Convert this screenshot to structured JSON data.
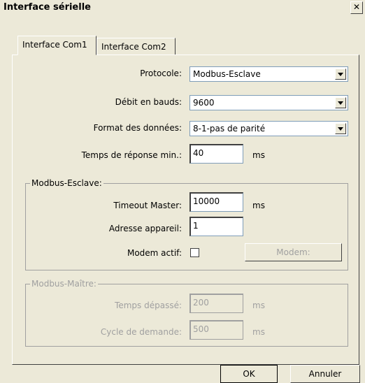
{
  "window": {
    "title": "Interface sérielle",
    "close_glyph": "✕"
  },
  "tabs": [
    {
      "label": "Interface Com1",
      "active": true
    },
    {
      "label": "Interface Com2",
      "active": false
    }
  ],
  "fields": {
    "protocole": {
      "label": "Protocole:",
      "value": "Modbus-Esclave"
    },
    "debit": {
      "label": "Débit en bauds:",
      "value": "9600"
    },
    "format": {
      "label": "Format des données:",
      "value": "8-1-pas de parité"
    },
    "temps_reponse": {
      "label": "Temps de réponse min.:",
      "value": "40",
      "unit": "ms"
    }
  },
  "modbus_esclave": {
    "title": "Modbus-Esclave:",
    "timeout_master": {
      "label": "Timeout Master:",
      "value": "10000",
      "unit": "ms"
    },
    "adresse": {
      "label": "Adresse appareil:",
      "value": "1"
    },
    "modem_actif": {
      "label": "Modem actif:",
      "checked": false
    },
    "modem_button": "Modem:"
  },
  "modbus_maitre": {
    "title": "Modbus-Maître:",
    "temps_depasse": {
      "label": "Temps dépassé:",
      "value": "200",
      "unit": "ms"
    },
    "cycle_demande": {
      "label": "Cycle de demande:",
      "value": "500",
      "unit": "ms"
    }
  },
  "buttons": {
    "ok": "OK",
    "cancel": "Annuler"
  }
}
